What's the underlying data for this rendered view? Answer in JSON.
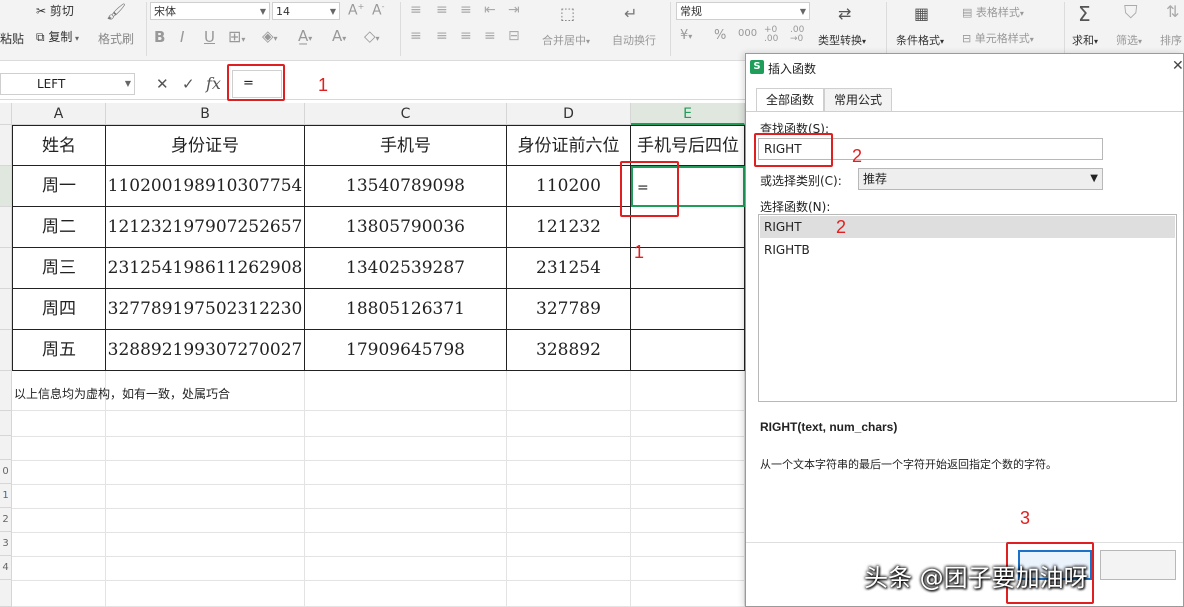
{
  "ribbon": {
    "paste_label": "粘贴",
    "cut_label": "剪切",
    "copy_label": "复制",
    "format_painter_label": "格式刷",
    "font_name": "宋体",
    "font_size": "14",
    "merge_center_label": "合并居中",
    "wrap_text_label": "自动换行",
    "number_format": "常规",
    "type_convert_label": "类型转换",
    "conditional_format_label": "条件格式",
    "table_style_label": "表格样式",
    "cell_style_label": "单元格样式",
    "sum_label": "求和",
    "filter_label": "筛选",
    "sort_label": "排序"
  },
  "formula_bar": {
    "name_box": "LEFT",
    "fx_label": "fx",
    "formula_value": "="
  },
  "annotations": {
    "step1": "1",
    "step2": "2",
    "step3": "3"
  },
  "sheet": {
    "columns": [
      "A",
      "B",
      "C",
      "D",
      "E"
    ],
    "headers": [
      "姓名",
      "身份证号",
      "手机号",
      "身份证前六位",
      "手机号后四位"
    ],
    "rows": [
      [
        "周一",
        "110200198910307754",
        "13540789098",
        "110200",
        "="
      ],
      [
        "周二",
        "121232197907252657",
        "13805790036",
        "121232",
        ""
      ],
      [
        "周三",
        "231254198611262908",
        "13402539287",
        "231254",
        ""
      ],
      [
        "周四",
        "327789197502312230",
        "18805126371",
        "327789",
        ""
      ],
      [
        "周五",
        "328892199307270027",
        "17909645798",
        "328892",
        ""
      ]
    ],
    "note": "以上信息均为虚构，如有一致，处属巧合",
    "row_numbers": [
      "0",
      "1",
      "2",
      "3",
      "4"
    ]
  },
  "dialog": {
    "title": "插入函数",
    "tabs": [
      "全部函数",
      "常用公式"
    ],
    "search_label": "查找函数(S):",
    "search_value": "RIGHT",
    "category_label": "或选择类别(C):",
    "category_value": "推荐",
    "select_label": "选择函数(N):",
    "functions": [
      "RIGHT",
      "RIGHTB"
    ],
    "signature": "RIGHT(text, num_chars)",
    "description": "从一个文本字符串的最后一个字符开始返回指定个数的字符。"
  },
  "watermark": "头条 @团子要加油呀",
  "colors": {
    "accent_green": "#1e9e5a",
    "annotation_red": "#e02020",
    "selection_blue": "#1a73c8"
  }
}
